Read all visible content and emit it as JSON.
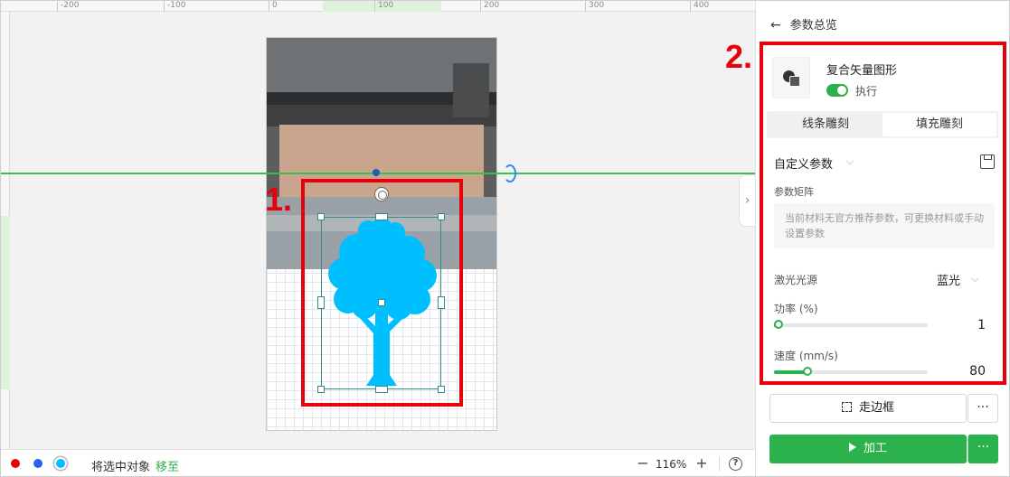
{
  "ruler": {
    "labels": [
      "-200",
      "-100",
      "0",
      "100",
      "200",
      "300",
      "400"
    ]
  },
  "annotations": {
    "label1": "1.",
    "label2": "2.",
    "color": "#e8000b"
  },
  "colors": {
    "accent": "#2bb24c",
    "tree": "#00bfff",
    "guide": "#3cbf4a"
  },
  "status_bar": {
    "color_dots": [
      "#e8000b",
      "#2563eb",
      "#00bfff"
    ],
    "text": "将选中对象",
    "link": "移至",
    "zoom_out": "−",
    "zoom": "116%",
    "zoom_in": "+",
    "help": "?"
  },
  "panel": {
    "back_icon": "←",
    "title": "参数总览",
    "object": {
      "name": "复合矢量图形",
      "toggle_label": "执行",
      "toggle_on": true
    },
    "tabs": [
      {
        "label": "线条雕刻",
        "active": false
      },
      {
        "label": "填充雕刻",
        "active": true
      }
    ],
    "preset": {
      "label": "自定义参数",
      "chevron": "⌵"
    },
    "matrix": {
      "label": "参数矩阵",
      "note": "当前材料无官方推荐参数，可更换材料或手动设置参数"
    },
    "laser": {
      "label": "激光光源",
      "value": "蓝光",
      "chevron": "⌵"
    },
    "power": {
      "label": "功率 (%)",
      "value": "1",
      "fraction": 0.01
    },
    "speed": {
      "label": "速度 (mm/s)",
      "value": "80",
      "fraction": 0.22
    },
    "frame_button": "走边框",
    "process_button": "加工",
    "more": "···",
    "collapse_icon": "›"
  }
}
